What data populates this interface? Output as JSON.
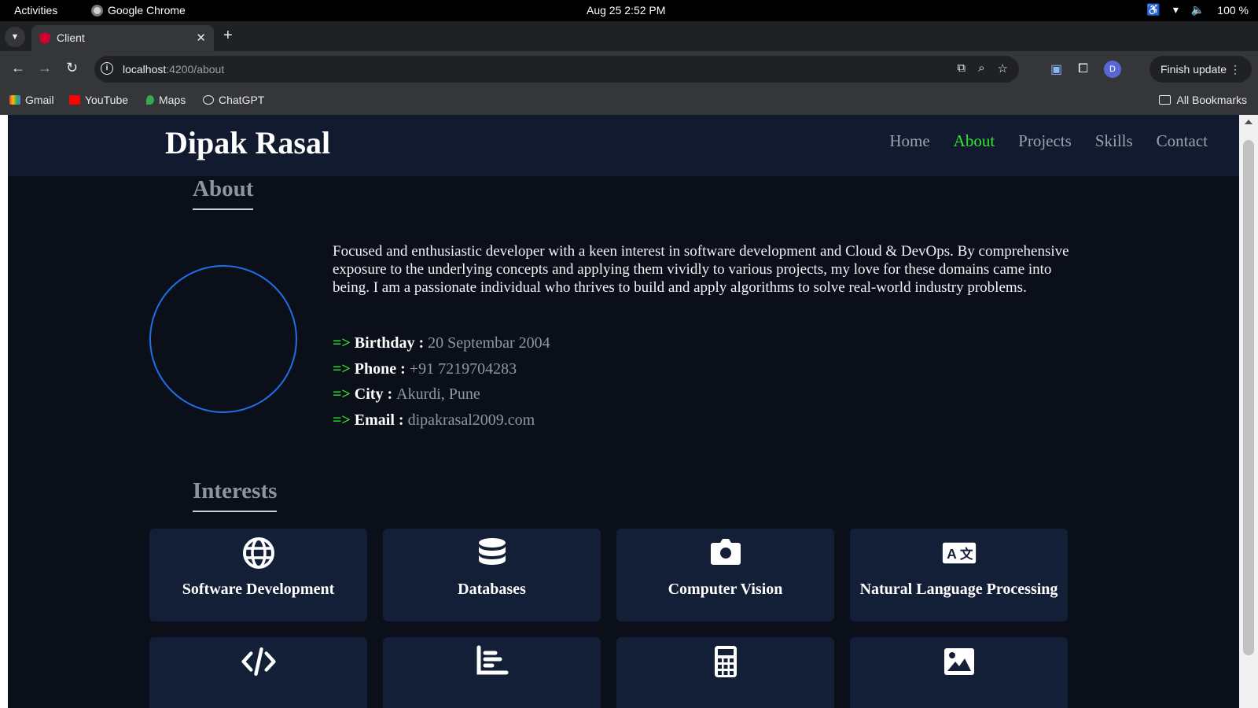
{
  "os": {
    "activities": "Activities",
    "app_name": "Google Chrome",
    "clock": "Aug 25  2:52 PM",
    "battery": "100 %"
  },
  "browser": {
    "tab_title": "Client",
    "url_host": "localhost",
    "url_path": ":4200/about",
    "finish_update": "Finish update",
    "profile_initial": "D",
    "bookmarks": [
      "Gmail",
      "YouTube",
      "Maps",
      "ChatGPT"
    ],
    "all_bookmarks": "All Bookmarks"
  },
  "site": {
    "brand": "Dipak Rasal",
    "nav": [
      "Home",
      "About",
      "Projects",
      "Skills",
      "Contact"
    ],
    "active_nav": "About"
  },
  "about": {
    "title": "About",
    "bio": "Focused and enthusiastic developer with a keen interest in software development and Cloud & DevOps. By comprehensive exposure to the underlying concepts and applying them vividly to various projects, my love for these domains came into being. I am a passionate individual who thrives to build and apply algorithms to solve real-world industry problems.",
    "arrow": "=>",
    "facts": [
      {
        "key": "Birthday :",
        "value": "20 Septembar 2004"
      },
      {
        "key": "Phone :",
        "value": "+91 7219704283"
      },
      {
        "key": "City :",
        "value": "Akurdi, Pune"
      },
      {
        "key": "Email :",
        "value": "dipakrasal2009.com"
      }
    ]
  },
  "interests": {
    "title": "Interests",
    "cards": [
      {
        "label": "Software Development",
        "icon": "globe-icon"
      },
      {
        "label": "Databases",
        "icon": "database-icon"
      },
      {
        "label": "Computer Vision",
        "icon": "camera-icon"
      },
      {
        "label": "Natural Language Processing",
        "icon": "translate-icon"
      },
      {
        "label": "",
        "icon": "code-icon"
      },
      {
        "label": "",
        "icon": "chart-icon"
      },
      {
        "label": "",
        "icon": "calculator-icon"
      },
      {
        "label": "",
        "icon": "image-icon"
      }
    ]
  },
  "colors": {
    "accent_green": "#2fe62f",
    "header_bg": "#111a2e",
    "page_bg": "#0b0f19",
    "card_bg": "#131f36",
    "avatar_ring": "#1e6fe8"
  }
}
